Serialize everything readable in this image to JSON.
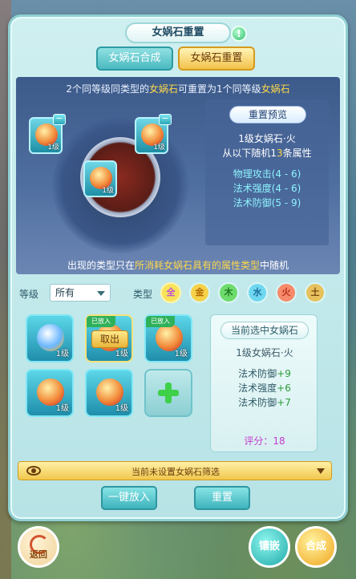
{
  "window": {
    "title": "女娲石重置",
    "help_icon": "!"
  },
  "tabs": [
    {
      "label": "女娲石合成",
      "active": false
    },
    {
      "label": "女娲石重置",
      "active": true
    }
  ],
  "stage": {
    "header_prefix": "2个同等级同类型的",
    "header_stone": "女娲石",
    "header_middle": "可重置为1个同等级",
    "header_suffix": "女娲石",
    "footer_prefix": "出现的类型只在",
    "footer_highlight": "所消耗女娲石具有的属性类型",
    "footer_suffix": "中随机",
    "slots": [
      {
        "level": "1级"
      },
      {
        "level": "1级"
      },
      {
        "level": "1级"
      }
    ],
    "remove_label": "−"
  },
  "preview": {
    "title": "重置预览",
    "stone_name": "1级女娲石·火",
    "random_prefix": "从以下随机1",
    "random_count": "3",
    "random_suffix": "条属性",
    "attrs": [
      "物理攻击(4 - 6)",
      "法术强度(4 - 6)",
      "法术防御(5 - 9)"
    ]
  },
  "filters": {
    "level_label": "等级",
    "level_value": "所有",
    "type_label": "类型",
    "types": [
      {
        "label": "全",
        "bg": "#f7e25a",
        "color": "#c04fd3"
      },
      {
        "label": "金",
        "bg": "#f5d24a",
        "color": "#b36a00"
      },
      {
        "label": "木",
        "bg": "#6edb6d",
        "color": "#1d7a1f"
      },
      {
        "label": "水",
        "bg": "#6fd8f0",
        "color": "#1a6c9b"
      },
      {
        "label": "火",
        "bg": "#f78a6a",
        "color": "#b22e18"
      },
      {
        "label": "土",
        "bg": "#e7c15d",
        "color": "#7a4a10"
      }
    ]
  },
  "bag": {
    "items": [
      {
        "level": "1级",
        "ribbon": "",
        "action": ""
      },
      {
        "level": "1级",
        "ribbon": "已放入",
        "action": "取出"
      },
      {
        "level": "1级",
        "ribbon": "已放入",
        "action": ""
      },
      {
        "level": "1级",
        "ribbon": "",
        "action": ""
      },
      {
        "level": "1级",
        "ribbon": "",
        "action": ""
      }
    ],
    "add_label": "+"
  },
  "current": {
    "title": "当前选中女娲石",
    "stone_name": "1级女娲石·火",
    "attrs": [
      {
        "name": "法术防御",
        "value": "+9"
      },
      {
        "name": "法术强度",
        "value": "+6"
      },
      {
        "name": "法术防御",
        "value": "+7"
      }
    ],
    "score_label": "评分：18"
  },
  "notice": {
    "text": "当前未设置女娲石筛选"
  },
  "buttons": {
    "put_all": "一键放入",
    "reset": "重置",
    "back": "返回",
    "inlay": "镶嵌",
    "combine": "合成"
  }
}
